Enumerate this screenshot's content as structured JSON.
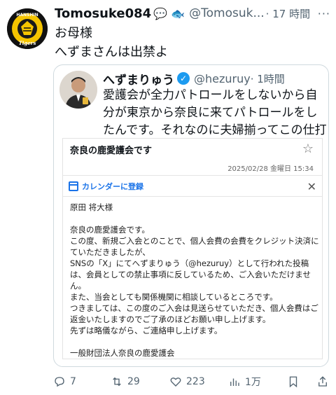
{
  "tweet": {
    "author_name": "Tomosuke084",
    "badge_emoji": "💬 🐟",
    "handle": "@Tomosuk...",
    "time": "· 17 時間",
    "more": "···",
    "avatar_text": "HANSHIN",
    "avatar_logo": "Tigers",
    "lines": [
      "お母様",
      "へずまさんは出禁よ"
    ]
  },
  "quote": {
    "author_name": "へずまりゅう",
    "verified_icon": "✓",
    "handle": "@hezuruy",
    "time": "· 1時間",
    "text": "愛護会が全力パトロールをしないから自分が東京から奈良に来てパトロールをしたんです。それなのに夫婦揃ってこの仕打ち。"
  },
  "email": {
    "subject": "奈良の鹿愛護会です",
    "date": "2025/02/28 金曜日 15:34",
    "calendar_label": "カレンダーに登録",
    "close": "✕",
    "star": "☆",
    "recipient": "原田 将大様",
    "body": [
      "奈良の鹿愛護会です。",
      "この度、新規ご入会とのことで、個人会費の会費をクレジット決済にていただきましたが、",
      "SNSの「X」にてへずまりゅう（@hezuruy）として行われた投稿は、会員としての禁止事項に反しているため、ご入会いただけません。",
      "また、当会としても関係機関に相談しているところです。",
      "つきましては、この度のご入会は見送らせていただき、個人会費はご返金いたしますのでご了承のほどお願い申し上げます。",
      "先ずは略儀ながら、ご連絡申し上げます。"
    ],
    "signature": "一般財団法人奈良の鹿愛護会"
  },
  "actions": {
    "replies": "7",
    "retweets": "29",
    "likes": "223",
    "views": "1万"
  }
}
